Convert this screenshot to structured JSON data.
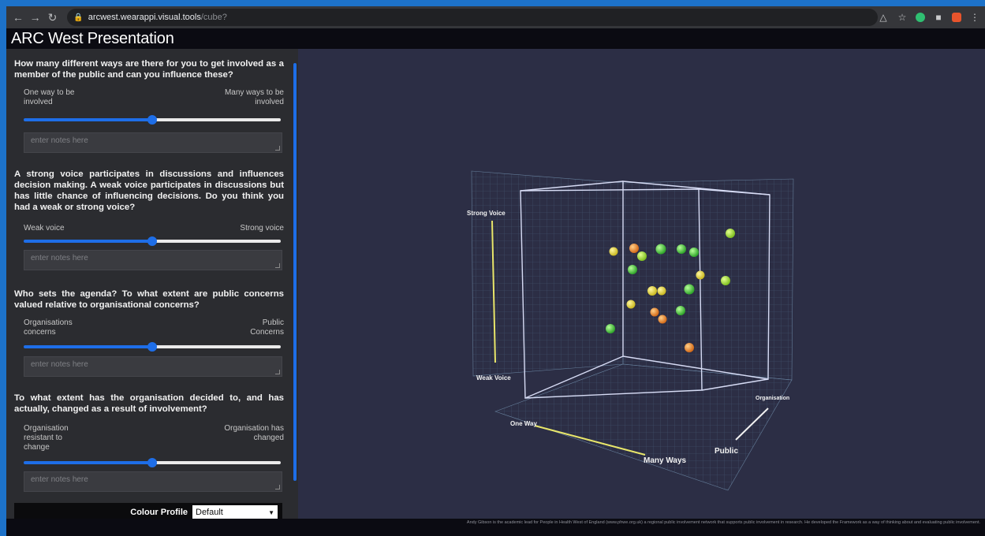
{
  "browser": {
    "url_host": "arcwest.wearappi.visual.tools",
    "url_path": "/cube?"
  },
  "app": {
    "title": "ARC West Presentation"
  },
  "questions": [
    {
      "text": "How many different ways are there for you to get involved as a member of the public and can you influence these?",
      "left_label": "One way to be involved",
      "right_label": "Many ways to be involved",
      "slider_value": 0.5,
      "notes_placeholder": "enter notes here"
    },
    {
      "text": "A strong voice participates in discussions and influences decision making. A weak voice participates in discussions but has little chance of influencing decisions. Do you think you had a weak or strong voice?",
      "left_label": "Weak voice",
      "right_label": "Strong voice",
      "slider_value": 0.5,
      "notes_placeholder": "enter notes here"
    },
    {
      "text": "Who sets the agenda? To what extent are public concerns valued relative to organisational concerns?",
      "left_label": "Organisations concerns",
      "right_label": "Public Concerns",
      "slider_value": 0.5,
      "notes_placeholder": "enter notes here"
    },
    {
      "text": "To what extent has the organisation decided to, and has actually, changed as a result of involvement?",
      "left_label": "Organisation resistant to change",
      "right_label": "Organisation has changed",
      "slider_value": 0.5,
      "notes_placeholder": "enter notes here"
    }
  ],
  "colour_profile": {
    "label": "Colour Profile",
    "selected": "Default"
  },
  "axes": {
    "voice_top": "Strong Voice",
    "voice_bottom": "Weak Voice",
    "ways_start": "One Way",
    "ways_end": "Many Ways",
    "org_end": "Organisation",
    "public_end": "Public"
  },
  "colors": {
    "accent": "#1e6ee8",
    "plot_bg": "#2c2e45",
    "frame": "#1d72c9"
  },
  "footer_text": "Andy Gibson is the academic lead for People in Health West of England (www.phwe.org.uk) a regional public involvement network that supports public involvement in research. He developed the Framework as a way of thinking about and evaluating public involvement."
}
